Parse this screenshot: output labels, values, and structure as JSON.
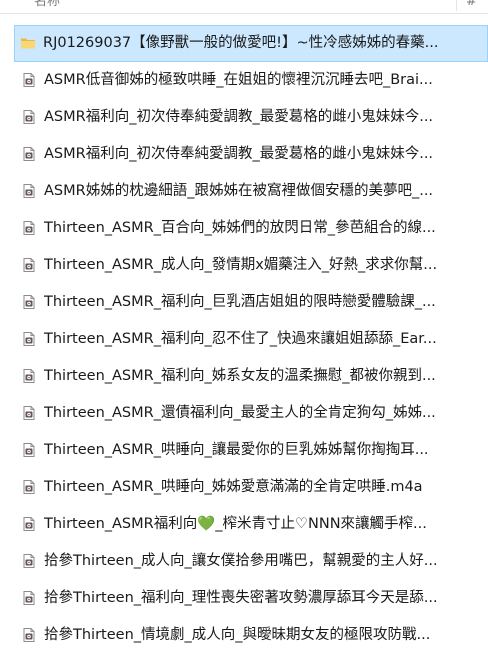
{
  "columns": {
    "name": "名称",
    "number": "#"
  },
  "files": [
    {
      "icon": "folder-icon",
      "name": "RJ01269037【像野獸一般的做愛吧!】~性冷感姊姊的春藥...",
      "selected": true
    },
    {
      "icon": "audio-file-icon",
      "name": "ASMR低音御姊的極致哄睡_在姐姐的懷裡沉沉睡去吧_Brai..."
    },
    {
      "icon": "audio-file-icon",
      "name": "ASMR福利向_初次侍奉純愛調教_最愛葛格的雌小鬼妹妹今..."
    },
    {
      "icon": "audio-file-icon",
      "name": "ASMR福利向_初次侍奉純愛調教_最愛葛格的雌小鬼妹妹今..."
    },
    {
      "icon": "audio-file-icon",
      "name": "ASMR姊姊的枕邊細語_跟姊姊在被窩裡做個安穩的美夢吧_..."
    },
    {
      "icon": "audio-file-icon",
      "name": "Thirteen_ASMR_百合向_姊姊們的放閃日常_參芭組合的線..."
    },
    {
      "icon": "audio-file-icon",
      "name": "Thirteen_ASMR_成人向_發情期x媚藥注入_好熱_求求你幫..."
    },
    {
      "icon": "audio-file-icon",
      "name": "Thirteen_ASMR_福利向_巨乳酒店姐姐的限時戀愛體驗課_..."
    },
    {
      "icon": "audio-file-icon",
      "name": "Thirteen_ASMR_福利向_忍不住了_快過來讓姐姐舔舔_Ear..."
    },
    {
      "icon": "audio-file-icon",
      "name": "Thirteen_ASMR_福利向_姊系女友的溫柔撫慰_都被你親到..."
    },
    {
      "icon": "audio-file-icon",
      "name": "Thirteen_ASMR_還債福利向_最愛主人的全肯定狗勾_姊姊..."
    },
    {
      "icon": "audio-file-icon",
      "name": "Thirteen_ASMR_哄睡向_讓最愛你的巨乳姊姊幫你掏掏耳..."
    },
    {
      "icon": "audio-file-icon",
      "name": "Thirteen_ASMR_哄睡向_姊姊愛意滿滿的全肯定哄睡.m4a"
    },
    {
      "icon": "audio-file-icon",
      "name": "Thirteen_ASMR福利向💚_榨米青寸止♡NNN來讓觸手榨..."
    },
    {
      "icon": "audio-file-icon",
      "name": "拾參Thirteen_成人向_讓女僕拾參用嘴巴，幫親愛的主人好..."
    },
    {
      "icon": "audio-file-icon",
      "name": "拾參Thirteen_福利向_理性喪失密著攻勢濃厚舔耳今天是舔..."
    },
    {
      "icon": "audio-file-icon",
      "name": "拾參Thirteen_情境劇_成人向_與曖昧期女友的極限攻防戰..."
    }
  ],
  "colors": {
    "selection_bg": "#cce8ff",
    "selection_border": "#99d1ff",
    "folder": "#f8d775",
    "text": "#1a1a1a"
  }
}
